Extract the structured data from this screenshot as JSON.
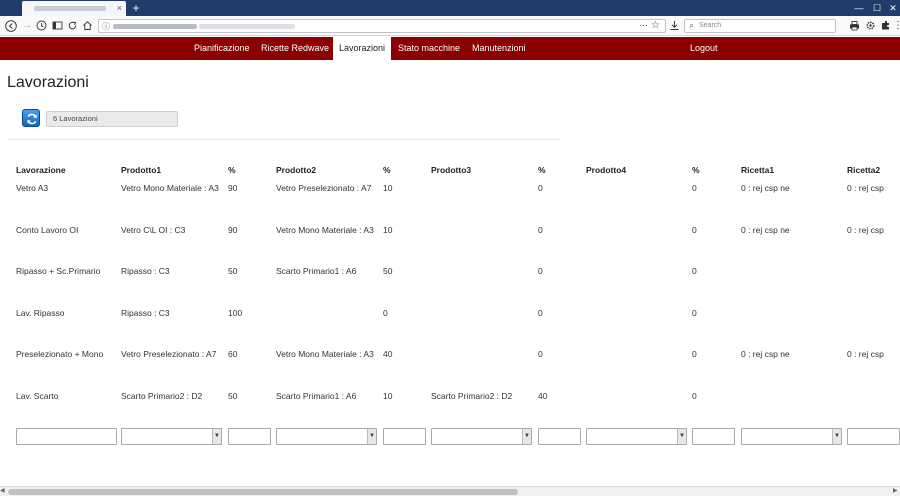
{
  "browser": {
    "new_tab_label": "+",
    "tab_close": "×",
    "minimize": "—",
    "maximize": "☐",
    "close": "✕",
    "search_placeholder": "Search"
  },
  "appnav": {
    "items": [
      "Pianificazione",
      "Ricette Redwave",
      "Lavorazioni",
      "Stato macchine",
      "Manutenzioni"
    ],
    "active": "Lavorazioni",
    "logout": "Logout"
  },
  "page": {
    "title": "Lavorazioni",
    "count": "6 Lavorazioni"
  },
  "table": {
    "headers": [
      "Lavorazione",
      "Prodotto1",
      "%",
      "Prodotto2",
      "%",
      "Prodotto3",
      "%",
      "Prodotto4",
      "%",
      "Ricetta1",
      "Ricetta2"
    ],
    "rows": [
      [
        "Vetro A3",
        "Vetro Mono Materiale : A3",
        "90",
        "Vetro Preselezionato : A7",
        "10",
        "",
        "0",
        "",
        "0",
        "0 : rej csp ne",
        "0 : rej csp"
      ],
      [
        "Conto Lavoro OI",
        "Vetro C\\L OI : C3",
        "90",
        "Vetro Mono Materiale : A3",
        "10",
        "",
        "0",
        "",
        "0",
        "0 : rej csp ne",
        "0 : rej csp"
      ],
      [
        "Ripasso + Sc.Primario",
        "Ripasso : C3",
        "50",
        "Scarto Primario1 : A6",
        "50",
        "",
        "0",
        "",
        "0",
        "",
        ""
      ],
      [
        "Lav. Ripasso",
        "Ripasso : C3",
        "100",
        "",
        "0",
        "",
        "0",
        "",
        "0",
        "",
        ""
      ],
      [
        "Preselezionato + Mono",
        "Vetro Preselezionato : A7",
        "60",
        "Vetro Mono Materiale : A3",
        "40",
        "",
        "0",
        "",
        "0",
        "0 : rej csp ne",
        "0 : rej csp"
      ],
      [
        "Lav. Scarto",
        "Scarto Primario2 : D2",
        "50",
        "Scarto Primario1 : A6",
        "10",
        "Scarto Primario2 : D2",
        "40",
        "",
        "0",
        "",
        ""
      ]
    ]
  },
  "icons": {
    "refresh": "refresh-icon",
    "accent": "#8b0000"
  }
}
